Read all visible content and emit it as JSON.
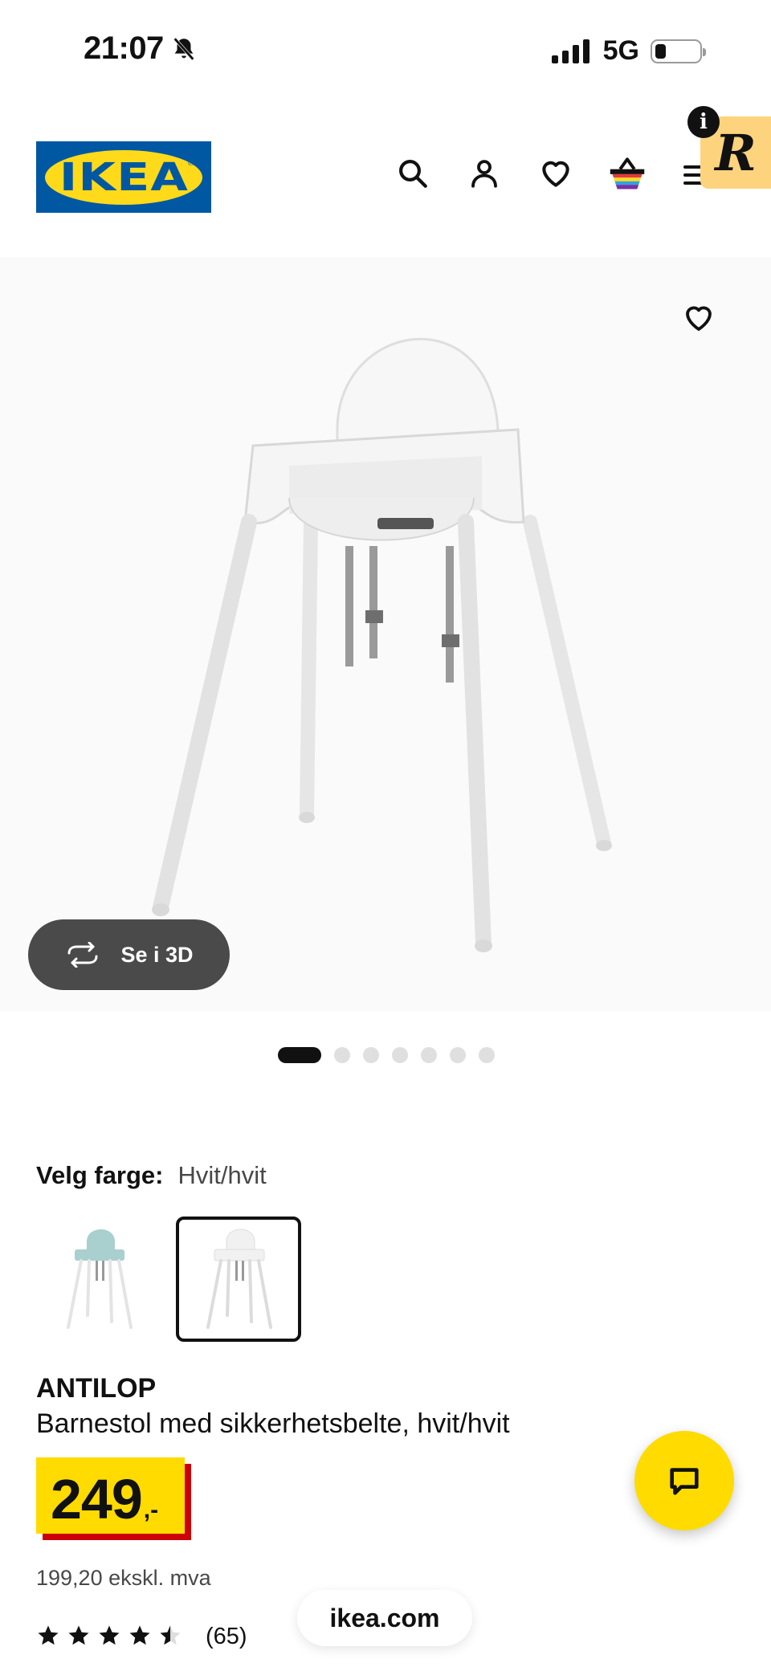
{
  "status_bar": {
    "time": "21:07",
    "network": "5G",
    "battery_level": 0.25
  },
  "header": {
    "logo_text": "IKEA",
    "brand_colors": {
      "blue": "#0058a3",
      "yellow": "#ffda1a"
    },
    "icons": [
      "search-icon",
      "account-icon",
      "wishlist-icon",
      "cart-icon",
      "menu-icon"
    ],
    "extension_badge_letter": "R",
    "info_letter": "i"
  },
  "gallery": {
    "view_3d_label": "Se i 3D",
    "image_count": 7,
    "active_index": 0
  },
  "color_selection": {
    "label": "Velg farge:",
    "value": "Hvit/hvit",
    "swatches": [
      {
        "name": "turquoise",
        "color": "#a9cfcf",
        "selected": false
      },
      {
        "name": "white",
        "color": "#f4f4f4",
        "selected": true
      }
    ]
  },
  "product": {
    "name": "ANTILOP",
    "description": "Barnestol med sikkerhetsbelte, hvit/hvit",
    "price_main": "249",
    "price_suffix": ",-",
    "price_ex_vat": "199,20 ekskl. mva",
    "rating": 4.5,
    "review_count": "(65)"
  },
  "browser": {
    "url": "ikea.com"
  },
  "theme": {
    "price_yellow": "#ffdb00",
    "price_red": "#cc0008",
    "chat_yellow": "#ffdb00"
  }
}
